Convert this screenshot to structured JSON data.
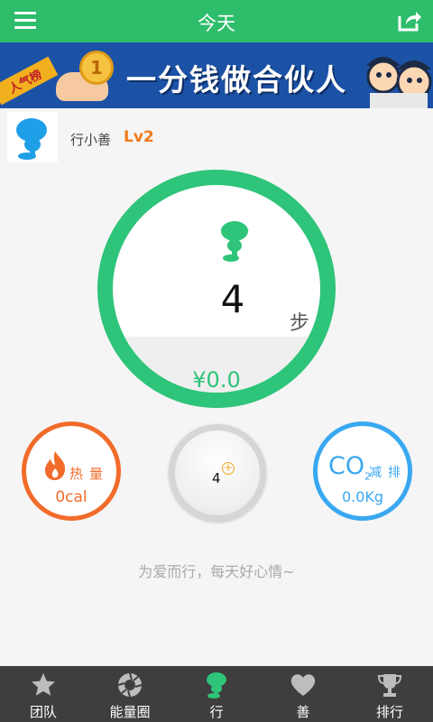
{
  "header": {
    "title": "今天",
    "menu_icon": "menu-icon",
    "share_icon": "share-icon"
  },
  "banner": {
    "badge": "人气榜",
    "coin_text": "1",
    "text": "一分钱做合伙人"
  },
  "profile": {
    "username": "行小善",
    "level": "Lv2"
  },
  "steps": {
    "value": "4",
    "unit": "步",
    "money": "¥0.0"
  },
  "calories": {
    "label": "热量",
    "value": "0cal",
    "icon": "flame-icon"
  },
  "mid_counter": {
    "value": "4",
    "plus": "+"
  },
  "co2": {
    "symbol": "CO",
    "subscript": "2",
    "label": "减排",
    "value": "0.0Kg"
  },
  "slogan": "为爱而行，每天好心情~",
  "tabs": [
    {
      "label": "团队",
      "icon": "star-icon",
      "active": false
    },
    {
      "label": "能量圈",
      "icon": "aperture-icon",
      "active": false
    },
    {
      "label": "行",
      "icon": "mascot-icon",
      "active": true
    },
    {
      "label": "善",
      "icon": "heart-icon",
      "active": false
    },
    {
      "label": "排行",
      "icon": "trophy-icon",
      "active": false
    }
  ],
  "colors": {
    "primary": "#2dbd6b",
    "ring": "#2ec479",
    "calorie": "#f26b2a",
    "co2": "#39a8f0",
    "level": "#ef7a1a",
    "tabbar": "#3e3e3e"
  }
}
